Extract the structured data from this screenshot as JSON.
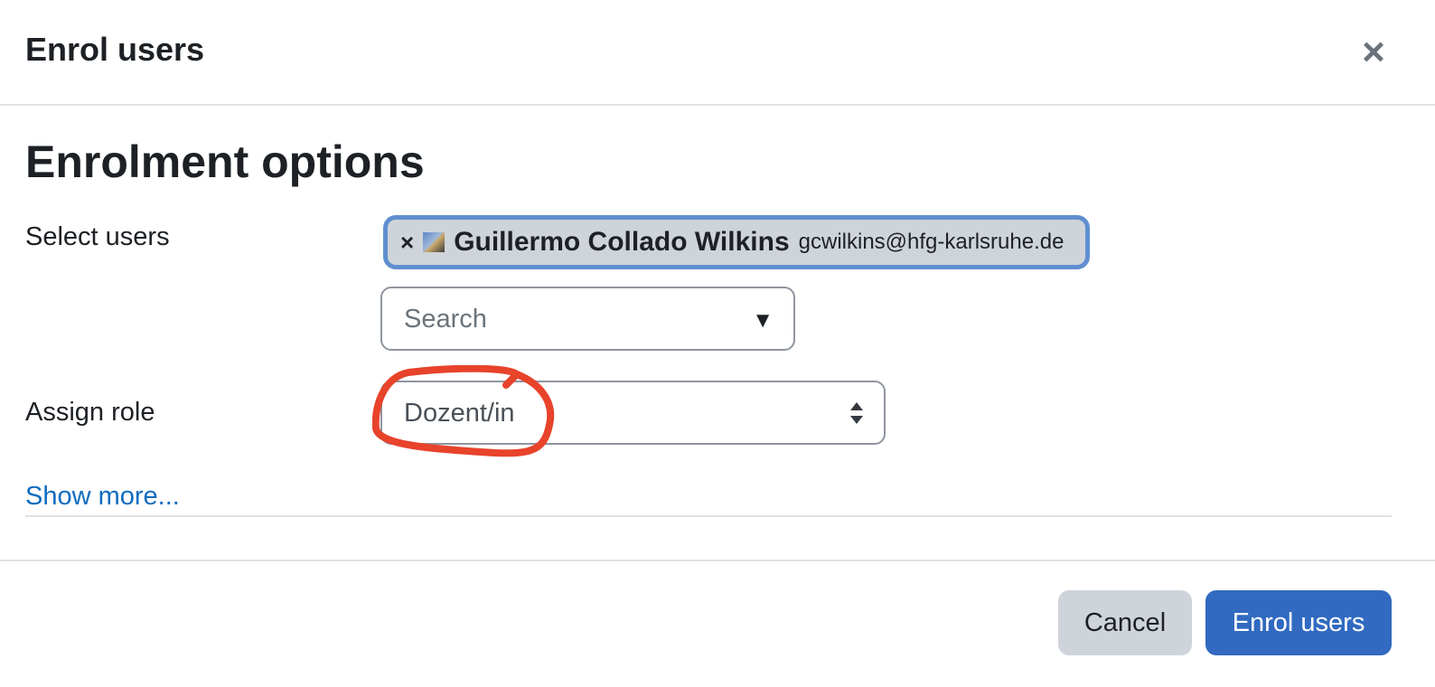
{
  "dialog": {
    "title": "Enrol users",
    "close_icon": "close-icon"
  },
  "section": {
    "title": "Enrolment options"
  },
  "select_users": {
    "label": "Select users",
    "selected": [
      {
        "remove_label": "×",
        "name": "Guillermo Collado Wilkins",
        "email": "gcwilkins@hfg-karlsruhe.de"
      }
    ],
    "search_placeholder": "Search",
    "dropdown_icon": "▼"
  },
  "assign_role": {
    "label": "Assign role",
    "selected_value": "Dozent/in"
  },
  "show_more": "Show more...",
  "footer": {
    "cancel_label": "Cancel",
    "submit_label": "Enrol users"
  },
  "colors": {
    "primary": "#316ac0",
    "link": "#0f6cbf",
    "annotation": "#e8432b"
  }
}
